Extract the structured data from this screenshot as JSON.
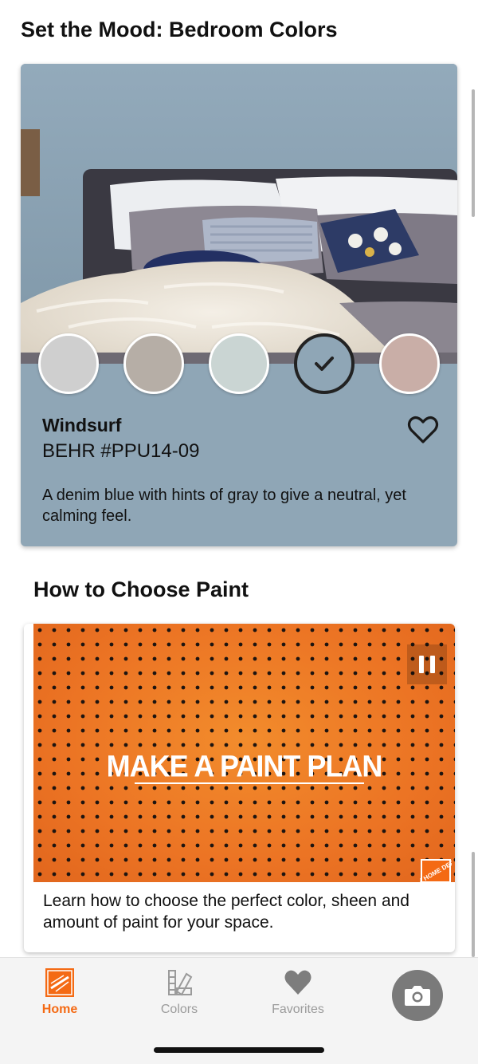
{
  "sections": {
    "mood_title": "Set the Mood: Bedroom Colors",
    "howto_title": "How to Choose Paint"
  },
  "mood_card": {
    "color_name": "Windsurf",
    "color_code": "BEHR #PPU14-09",
    "description": "A denim blue with hints of gray to give a neutral, yet calming feel.",
    "background_color": "#8fa6b6",
    "swatches": [
      {
        "color": "#cfcfcf",
        "selected": false
      },
      {
        "color": "#b6aea6",
        "selected": false
      },
      {
        "color": "#cad5d3",
        "selected": false
      },
      {
        "color": "#8fa6b6",
        "selected": true
      },
      {
        "color": "#c9aea7",
        "selected": false
      }
    ]
  },
  "video_card": {
    "video_title": "MAKE A PAINT PLAN",
    "description": "Learn how to choose the perfect color, sheen and amount of paint for your space.",
    "logo_text": "THE HOME DEPOT",
    "accent_color": "#ec7424"
  },
  "tabbar": {
    "tabs": [
      {
        "label": "Home",
        "icon": "home-depot-logo-icon",
        "active": true
      },
      {
        "label": "Colors",
        "icon": "color-chips-icon",
        "active": false
      },
      {
        "label": "Favorites",
        "icon": "heart-icon",
        "active": false
      }
    ],
    "camera": {
      "icon": "camera-icon"
    },
    "active_color": "#f46a14",
    "inactive_color": "#9b9b9b"
  }
}
